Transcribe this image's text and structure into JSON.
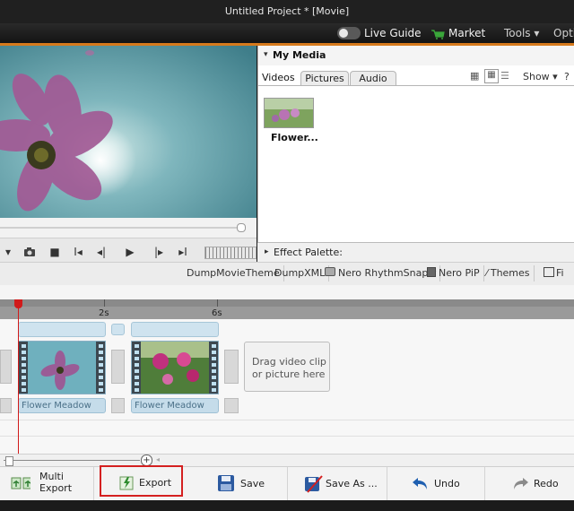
{
  "window": {
    "title": "Untitled Project * [Movie]"
  },
  "menubar": {
    "live_guide": "Live Guide",
    "market": "Market",
    "tools": "Tools",
    "options": "Opti"
  },
  "media": {
    "header": "My Media",
    "tabs": [
      "Videos",
      "Pictures",
      "Audio"
    ],
    "show_label": "Show",
    "items": [
      {
        "label": "Flower..."
      }
    ]
  },
  "effect_palette": {
    "label": "Effect Palette:"
  },
  "plugins": [
    "DumpMovieTheme",
    "DumpXML",
    "Nero RhythmSnap",
    "Nero PiP",
    "Themes",
    "Fi"
  ],
  "timeline": {
    "ruler": {
      "tick1": "2s",
      "tick2": "6s"
    },
    "clips": [
      {
        "label": "Flower Meadow"
      },
      {
        "label": "Flower Meadow"
      }
    ],
    "dropzone": "Drag video clip or picture here"
  },
  "toolbar": {
    "multi_export": "Multi Export",
    "export": "Export",
    "save": "Save",
    "save_as": "Save As ...",
    "undo": "Undo",
    "redo": "Redo"
  },
  "colors": {
    "accent": "#d67a1c",
    "highlight_border": "#d42020",
    "playhead": "#d11a1a"
  }
}
